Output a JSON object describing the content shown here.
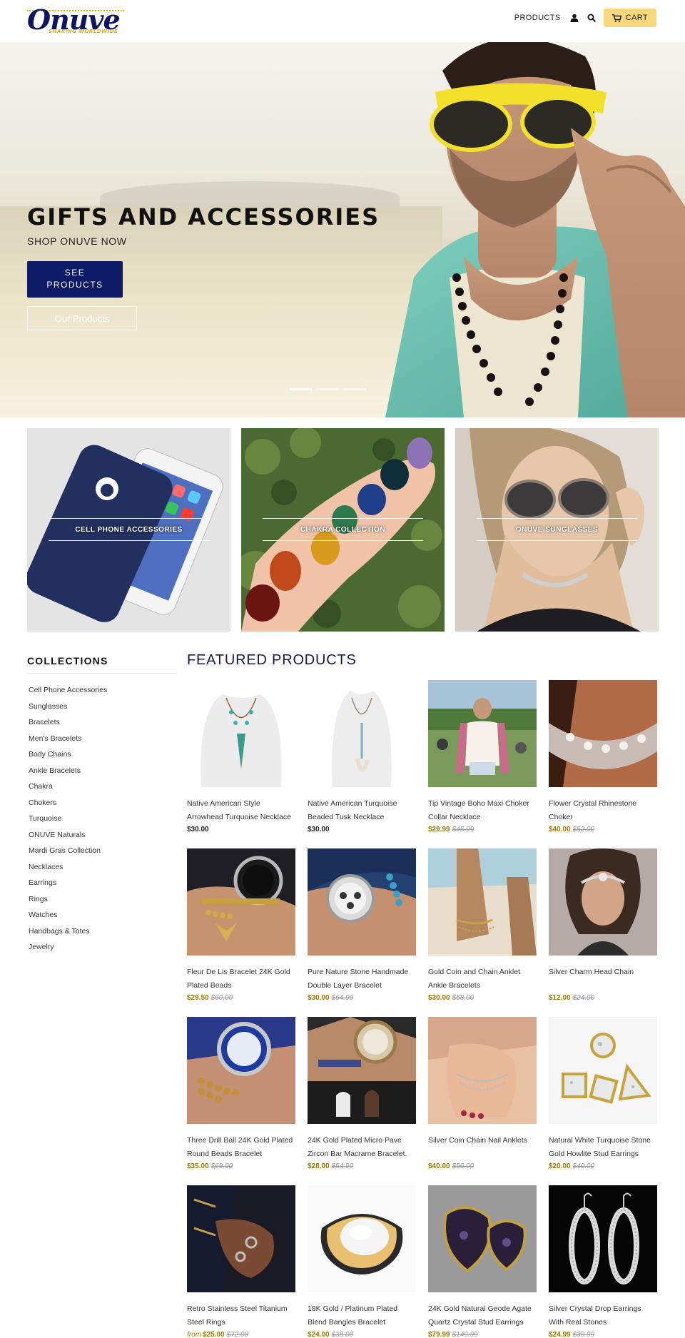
{
  "header": {
    "logo_text": "Onuve",
    "logo_tagline": "SHARING WORLDWIDE",
    "nav_products": "PRODUCTS",
    "cart_label": "CART"
  },
  "hero": {
    "title": "GIFTS AND ACCESSORIES",
    "subtitle": "SHOP ONUVE NOW",
    "button_line1": "SEE",
    "button_line2": "PRODUCTS",
    "ghost_button": "Our Products",
    "slides": 3,
    "active_slide": 1
  },
  "collections_tiles": [
    {
      "label": "CELL PHONE ACCESSORIES"
    },
    {
      "label": "CHAKRA COLLECTION"
    },
    {
      "label": "ONUVE SUNGLASSES"
    }
  ],
  "sidebar": {
    "title": "COLLECTIONS",
    "items": [
      "Cell Phone Accessories",
      "Sunglasses",
      "Bracelets",
      "Men's Bracelets",
      "Body Chains",
      "Ankle Bracelets",
      "Chakra",
      "Chokers",
      "Turquoise",
      "ONUVE Naturals",
      "Mardi Gras Collection",
      "Necklaces",
      "Earrings",
      "Rings",
      "Watches",
      "Handbags & Totes",
      "Jewelry"
    ]
  },
  "featured": {
    "title": "FEATURED PRODUCTS",
    "products": [
      {
        "name": "Native American Style Arrowhead Turquoise Necklace",
        "price": "$30.00",
        "old_price": "",
        "from": "",
        "sale": false
      },
      {
        "name": "Native American Turquoise Beaded Tusk Necklace",
        "price": "$30.00",
        "old_price": "",
        "from": "",
        "sale": false
      },
      {
        "name": "Tip Vintage Boho Maxi Choker Collar Necklace",
        "price": "$29.99",
        "old_price": "$45.99",
        "from": "",
        "sale": true
      },
      {
        "name": "Flower Crystal Rhinestone Choker",
        "price": "$40.00",
        "old_price": "$52.00",
        "from": "",
        "sale": true
      },
      {
        "name": "Fleur De Lis Bracelet 24K Gold Plated Beads",
        "price": "$29.50",
        "old_price": "$60.00",
        "from": "",
        "sale": true
      },
      {
        "name": "Pure Nature Stone Handmade Double Layer Bracelet",
        "price": "$30.00",
        "old_price": "$64.99",
        "from": "",
        "sale": true
      },
      {
        "name": "Gold Coin and Chain Anklet Ankle Bracelets",
        "price": "$30.00",
        "old_price": "$58.00",
        "from": "",
        "sale": true
      },
      {
        "name": "Silver Charm Head Chain",
        "price": "$12.00",
        "old_price": "$24.00",
        "from": "",
        "sale": true
      },
      {
        "name": "Three Drill Ball 24K Gold Plated Round Beads Bracelet",
        "price": "$35.00",
        "old_price": "$69.00",
        "from": "",
        "sale": true
      },
      {
        "name": "24K Gold Plated Micro Pave Zircon Bar Macrame Bracelet.",
        "price": "$28.00",
        "old_price": "$54.99",
        "from": "",
        "sale": true
      },
      {
        "name": "Silver Coin Chain Nail Anklets",
        "price": "$40.00",
        "old_price": "$56.00",
        "from": "",
        "sale": true
      },
      {
        "name": "Natural White Turquoise Stone Gold Howlite Stud Earrings",
        "price": "$20.00",
        "old_price": "$40.00",
        "from": "",
        "sale": true
      },
      {
        "name": "Retro Stainless Steel Titanium Steel Rings",
        "price": "$25.00",
        "old_price": "$72.00",
        "from": "from",
        "sale": true
      },
      {
        "name": "18K Gold / Platinum Plated Blend Bangles Bracelet",
        "price": "$24.00",
        "old_price": "$38.00",
        "from": "",
        "sale": true
      },
      {
        "name": "24K Gold Natural Geode Agate Quartz Crystal Stud Earrings",
        "price": "$79.99",
        "old_price": "$149.99",
        "from": "",
        "sale": true
      },
      {
        "name": "Silver Crystal Drop Earrings With Real Stones",
        "price": "$24.99",
        "old_price": "$39.99",
        "from": "",
        "sale": true
      }
    ]
  },
  "colors": {
    "brand_navy": "#0d1a66",
    "cart_yellow": "#f8d77d",
    "sale_gold": "#9a7b00"
  }
}
